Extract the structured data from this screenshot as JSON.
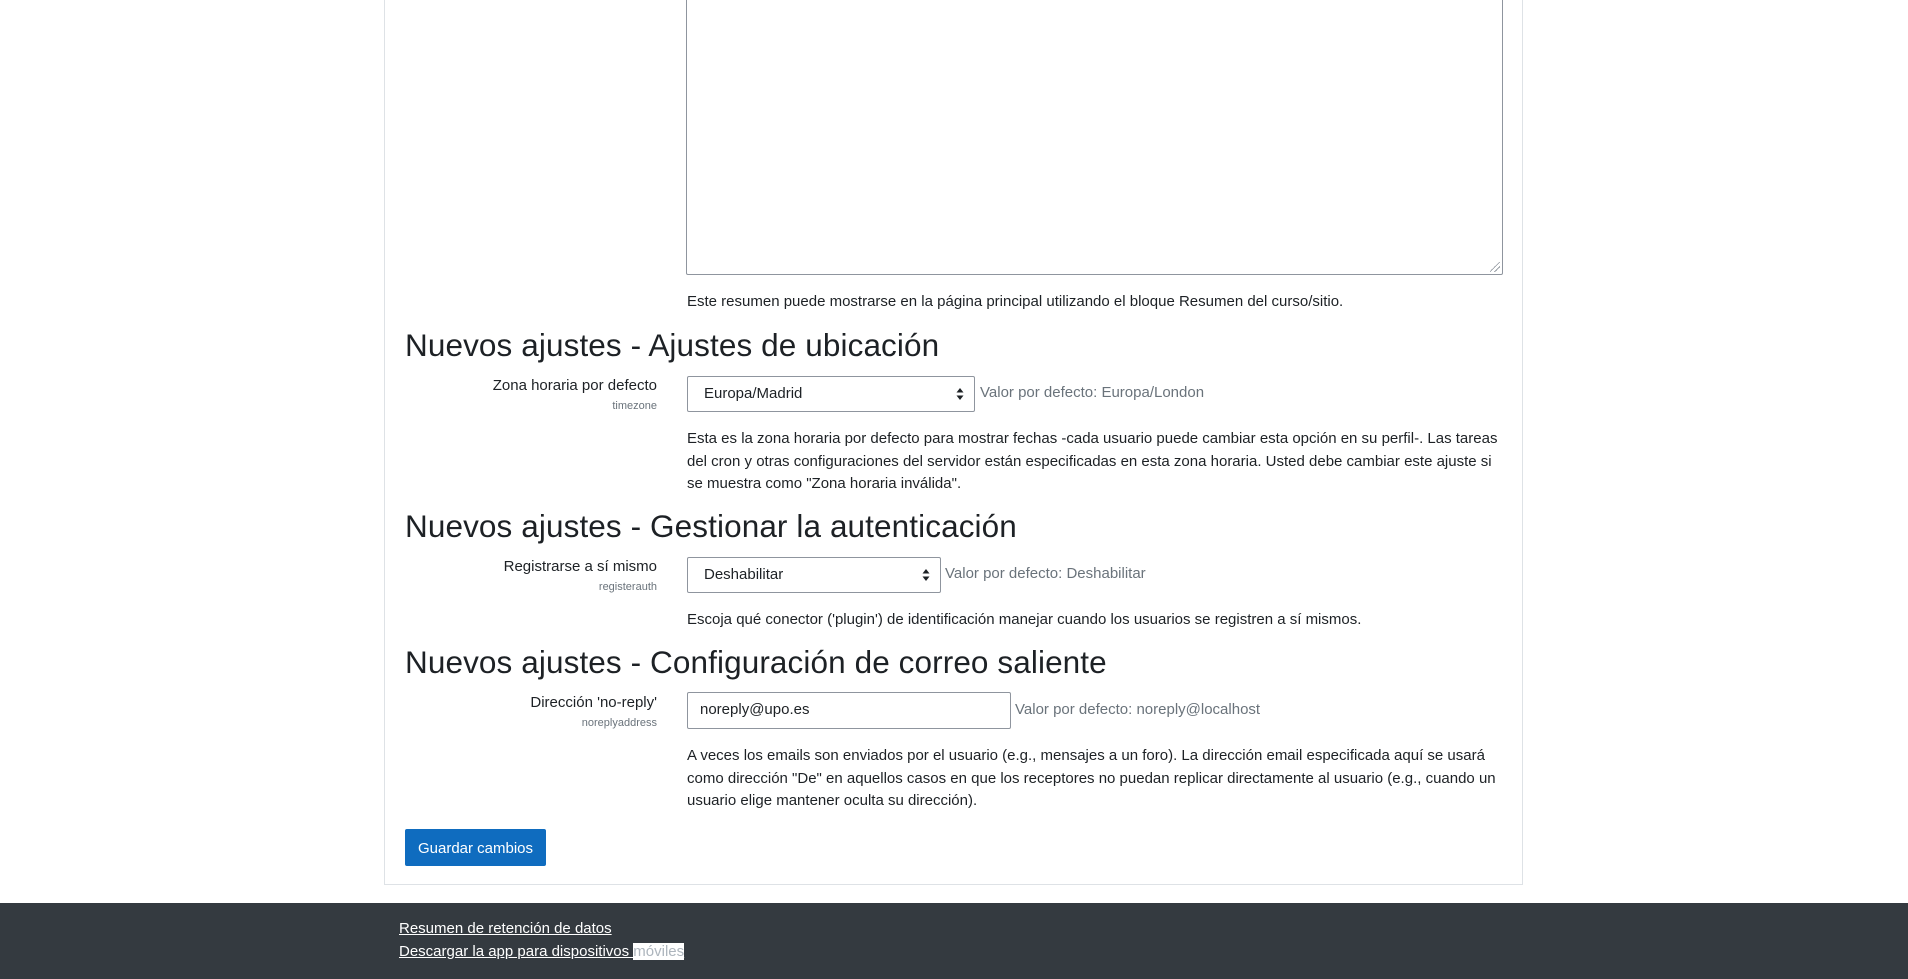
{
  "summary_field": {
    "description": "Este resumen puede mostrarse en la página principal utilizando el bloque Resumen del curso/sitio."
  },
  "sections": [
    {
      "heading": "Nuevos ajustes - Ajustes de ubicación",
      "label": "Zona horaria por defecto",
      "sublabel": "timezone",
      "control": "select",
      "value": "Europa/Madrid",
      "default": "Valor por defecto: Europa/London",
      "description": "Esta es la zona horaria por defecto para mostrar fechas -cada usuario puede cambiar esta opción en su perfil-. Las tareas del cron y otras configuraciones del servidor están especificadas en esta zona horaria. Usted debe cambiar este ajuste si se muestra como \"Zona horaria inválida\"."
    },
    {
      "heading": "Nuevos ajustes - Gestionar la autenticación",
      "label": "Registrarse a sí mismo",
      "sublabel": "registerauth",
      "control": "select",
      "value": "Deshabilitar",
      "default": "Valor por defecto: Deshabilitar",
      "description": "Escoja qué conector ('plugin') de identificación manejar cuando los usuarios se registren a sí mismos."
    },
    {
      "heading": "Nuevos ajustes - Configuración de correo saliente",
      "label": "Dirección 'no-reply'",
      "sublabel": "noreplyaddress",
      "control": "text",
      "value": "noreply@upo.es",
      "default": "Valor por defecto: noreply@localhost",
      "description": "A veces los emails son enviados por el usuario (e.g., mensajes a un foro). La dirección email especificada aquí se usará como dirección \"De\" en aquellos casos en que los receptores no puedan replicar directamente al usuario (e.g., cuando un usuario elige mantener oculta su dirección)."
    }
  ],
  "save_button": "Guardar cambios",
  "footer": {
    "link1": "Resumen de retención de datos",
    "link2_main": "Descargar la app para dispositivos ",
    "link2_highlight": "móviles"
  },
  "colors": {
    "primary": "#0f6cbf",
    "footer_bg": "#343a40",
    "muted": "#6a737b"
  }
}
